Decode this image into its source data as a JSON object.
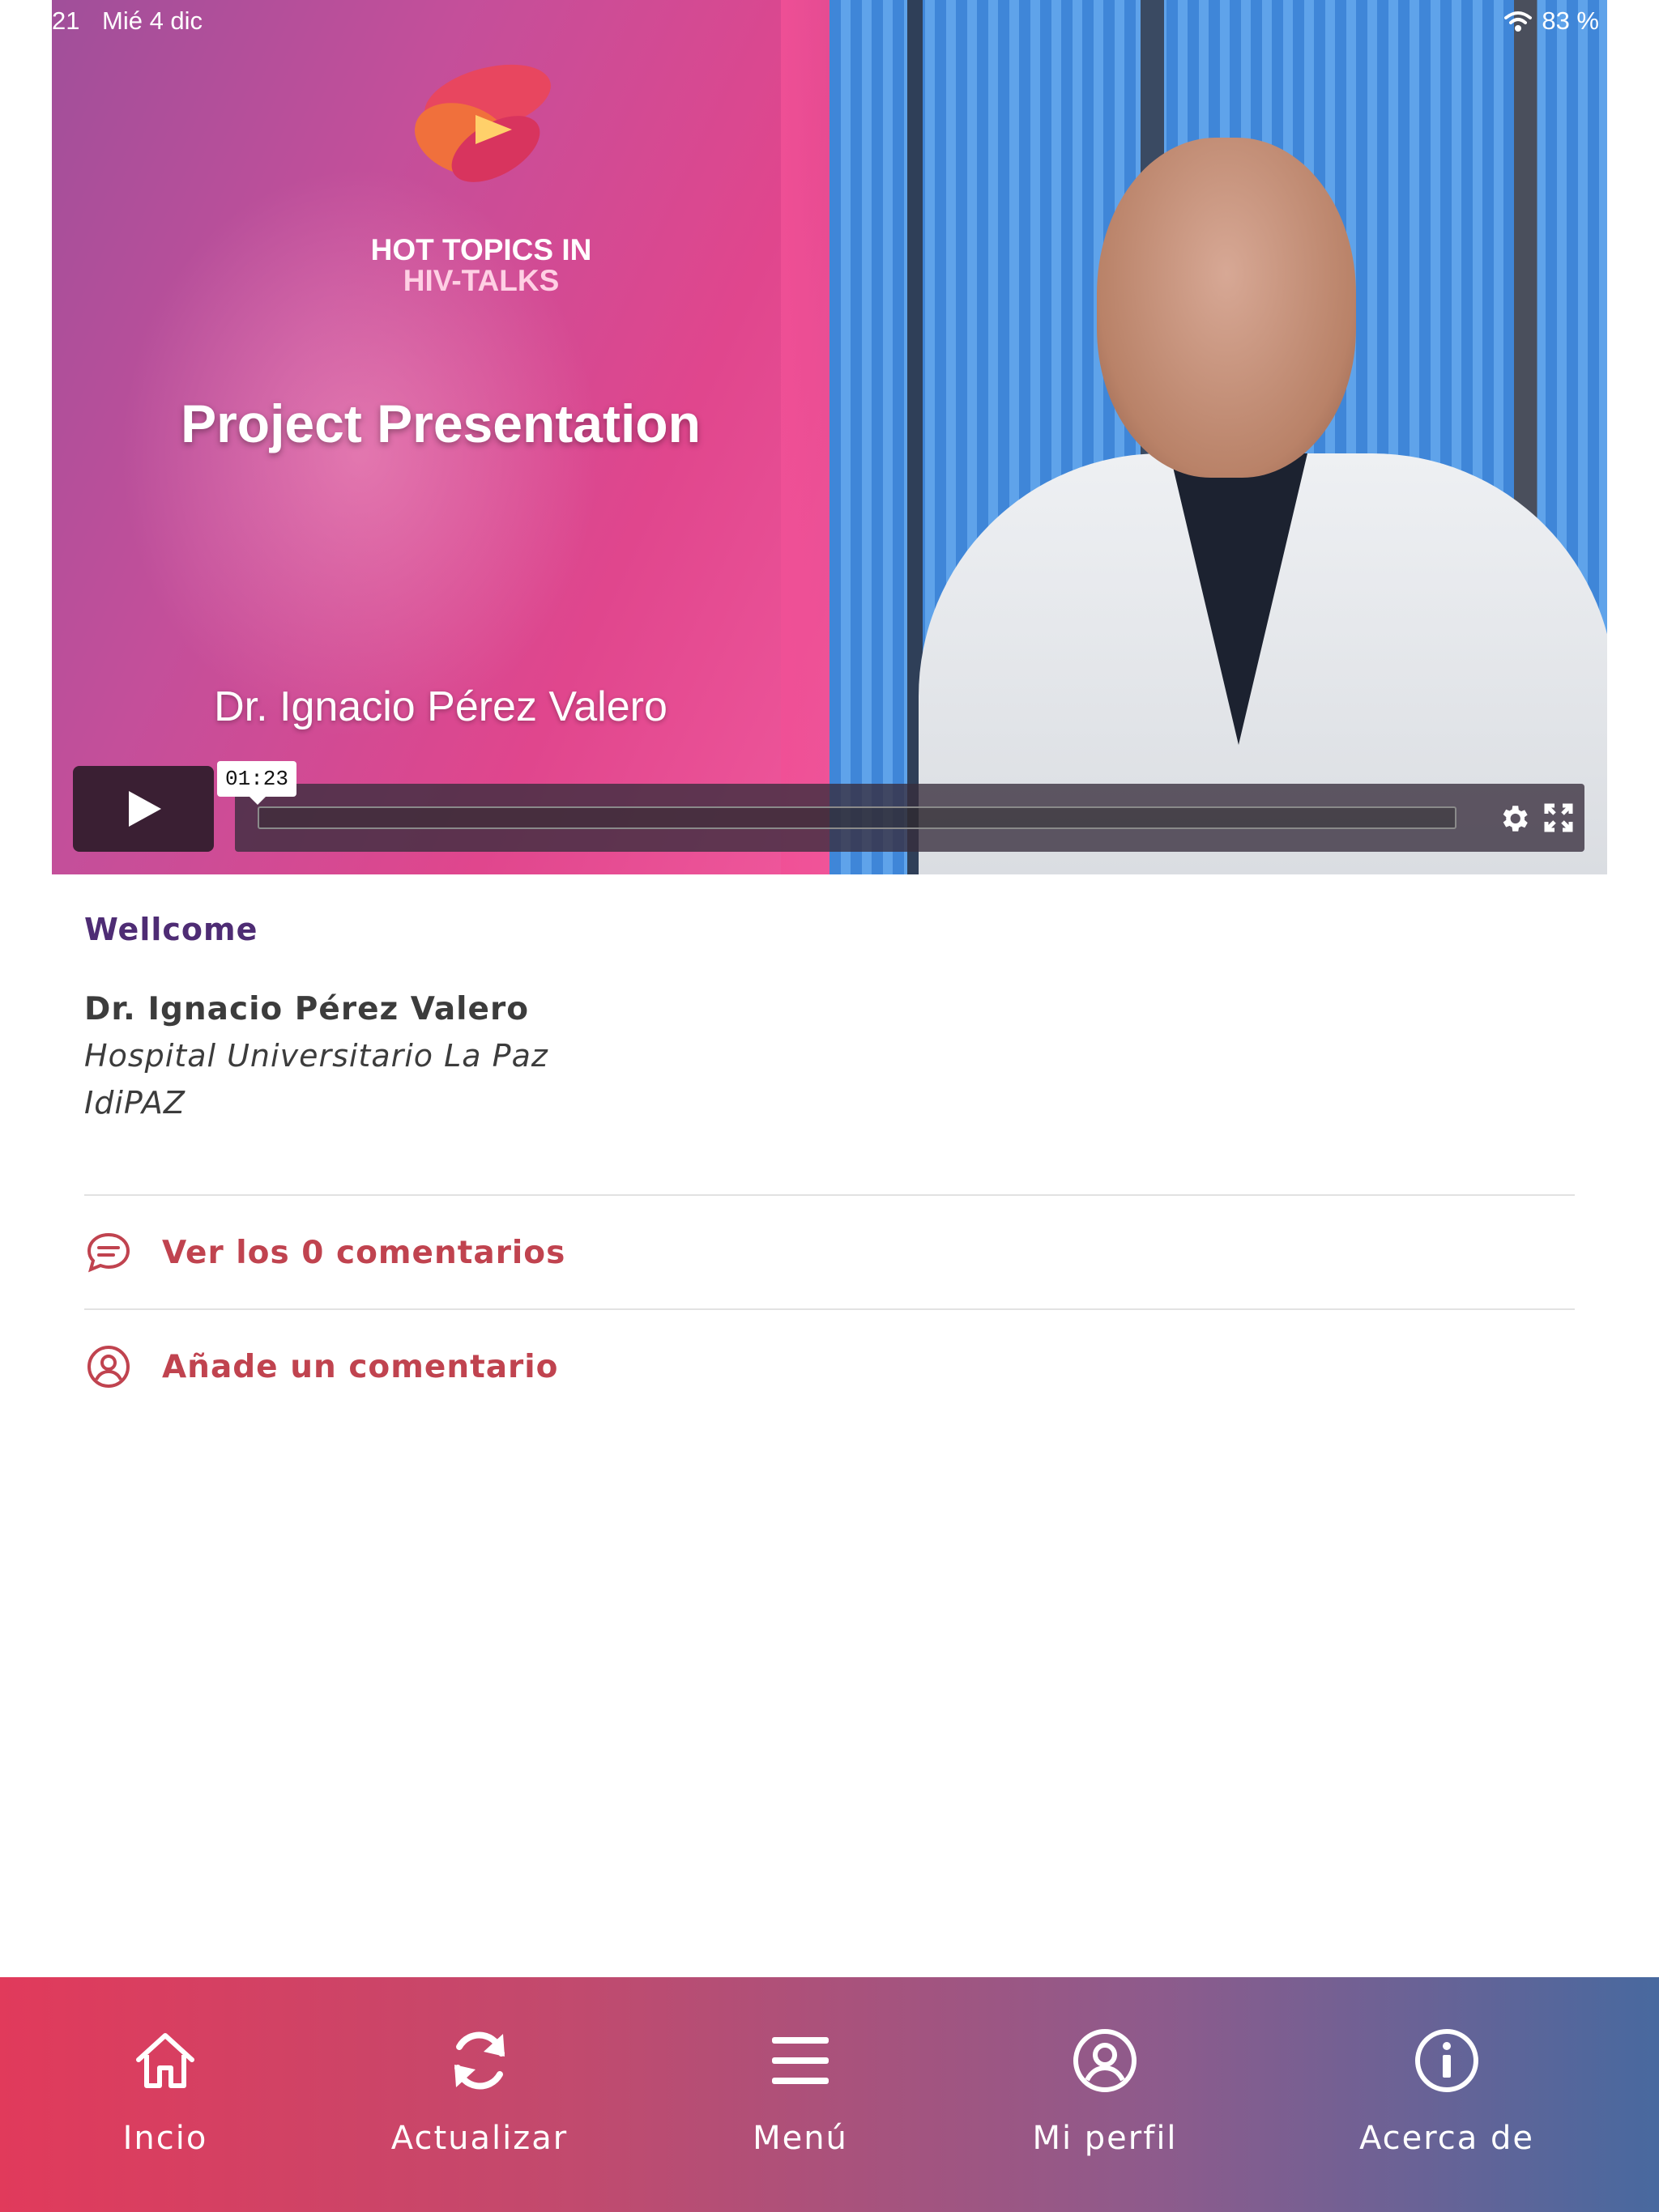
{
  "status_bar": {
    "time": "21",
    "date": "Mié 4 dic",
    "battery": "83 %"
  },
  "video": {
    "logo_line1": "HOT TOPICS IN",
    "logo_line2": "HIV-TALKS",
    "title": "Project Presentation",
    "speaker": "Dr. Ignacio Pérez Valero",
    "timestamp": "01:23",
    "progress": 0.0
  },
  "content": {
    "section_title": "Wellcome",
    "speaker_name": "Dr. Ignacio Pérez Valero",
    "institution_1": "Hospital Universitario La Paz",
    "institution_2": "IdiPAZ"
  },
  "actions": {
    "view_comments": "Ver los 0 comentarios",
    "add_comment": "Añade un comentario"
  },
  "tabbar": {
    "items": [
      {
        "label": "Incio",
        "icon": "home-icon"
      },
      {
        "label": "Actualizar",
        "icon": "refresh-icon"
      },
      {
        "label": "Menú",
        "icon": "menu-icon"
      },
      {
        "label": "Mi perfil",
        "icon": "user-circle-icon"
      },
      {
        "label": "Acerca de",
        "icon": "info-icon"
      }
    ]
  },
  "colors": {
    "accent_red": "#c0434f",
    "title_purple": "#4e2c74",
    "tabbar_start": "#e13a5b",
    "tabbar_end": "#48699f"
  }
}
